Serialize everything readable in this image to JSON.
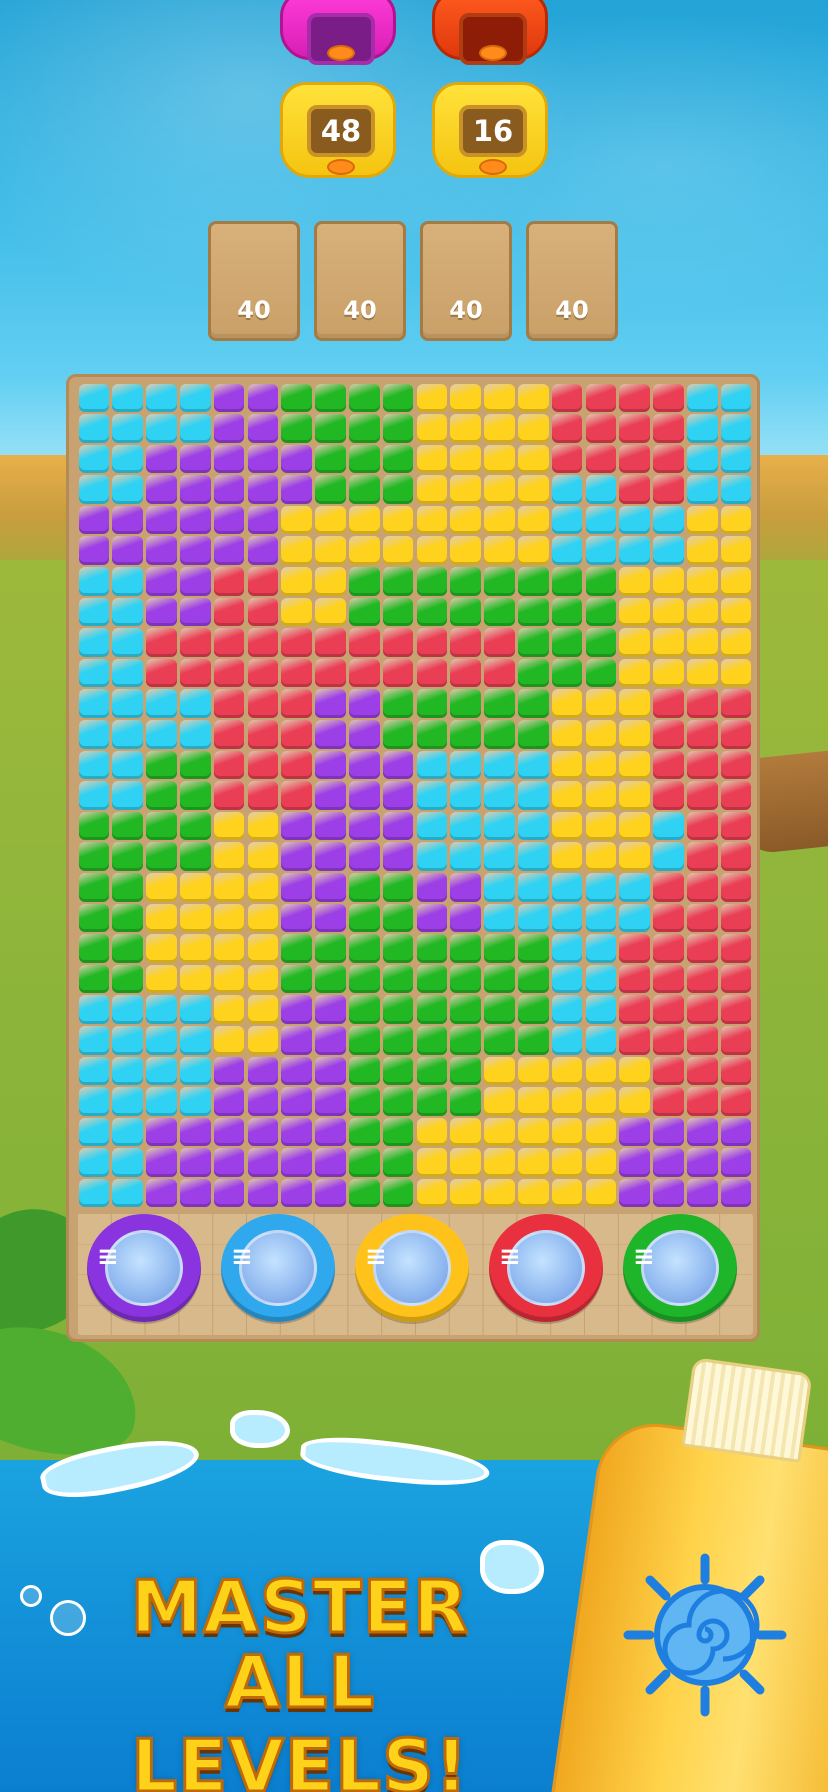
{
  "ducks": {
    "top_row": [
      {
        "color": "pink"
      },
      {
        "color": "red"
      }
    ],
    "counters": [
      {
        "color": "yellow",
        "count": "48"
      },
      {
        "color": "yellow",
        "count": "16"
      }
    ]
  },
  "slots": [
    "40",
    "40",
    "40",
    "40"
  ],
  "board": {
    "columns": 20,
    "rows": 27,
    "palette": {
      "C": "#2fd2f3",
      "P": "#9c3fe6",
      "G": "#22b824",
      "Y": "#ffd21e",
      "R": "#ea3e55"
    },
    "grid": [
      "CCCCPPGGGGYYYYRRRRCC",
      "CCCCPPGGGGYYYYRRRRCC",
      "CCPPPPPGGGYYYYRRRRCC",
      "CCPPPPPGGGYYYYCCRRCC",
      "PPPPPPYYYYYYYYCCCCYY",
      "PPPPPPYYYYYYYYCCCCYY",
      "CCPPRRYYGGGGGGGGYYYY",
      "CCPPRRYYGGGGGGGGYYYY",
      "CCRRRRRRRRRRRGGGYYYY",
      "CCRRRRRRRRRRRGGGYYYY",
      "CCCCRRRPPGGGGGYYYRRR",
      "CCCCRRRPPGGGGGYYYRRR",
      "CCGGRRRPPPCCCCYYYRRR",
      "CCGGRRRPPPCCCCYYYRRR",
      "GGGGYYPPPPCCCCYYYCRR",
      "GGGGYYPPPPCCCCYYYCRR",
      "GGYYYYPPGGPPCCCCCRRR",
      "GGYYYYPPGGPPCCCCCRRR",
      "GGYYYYGGGGGGGGCCRRRR",
      "GGYYYYGGGGGGGGCCRRRR",
      "CCCCYYPPGGGGGGCCRRRR",
      "CCCCYYPPGGGGGGCCRRRR",
      "CCCCPPPPGGGGYYYYYRRR",
      "CCCCPPPPGGGGYYYYYRRR",
      "CCPPPPPPGGYYYYYYPPPP",
      "CCPPPPPPGGYYYYYYPPPP",
      "CCPPPPPPGGYYYYYYPPPP"
    ]
  },
  "pools": [
    {
      "color": "#8a34e0",
      "icon": "ladder-icon"
    },
    {
      "color": "#2fa8ee",
      "icon": "ladder-icon"
    },
    {
      "color": "#ffc21a",
      "icon": "ladder-icon"
    },
    {
      "color": "#e8303f",
      "icon": "ladder-icon"
    },
    {
      "color": "#1fb52a",
      "icon": "ladder-icon"
    }
  ],
  "banner": {
    "line1": "MASTER",
    "line2": "ALL LEVELS!"
  },
  "decor": {
    "bottle_icon": "sunscreen-bottle-icon",
    "sun_icon": "sun-spiral-icon"
  }
}
